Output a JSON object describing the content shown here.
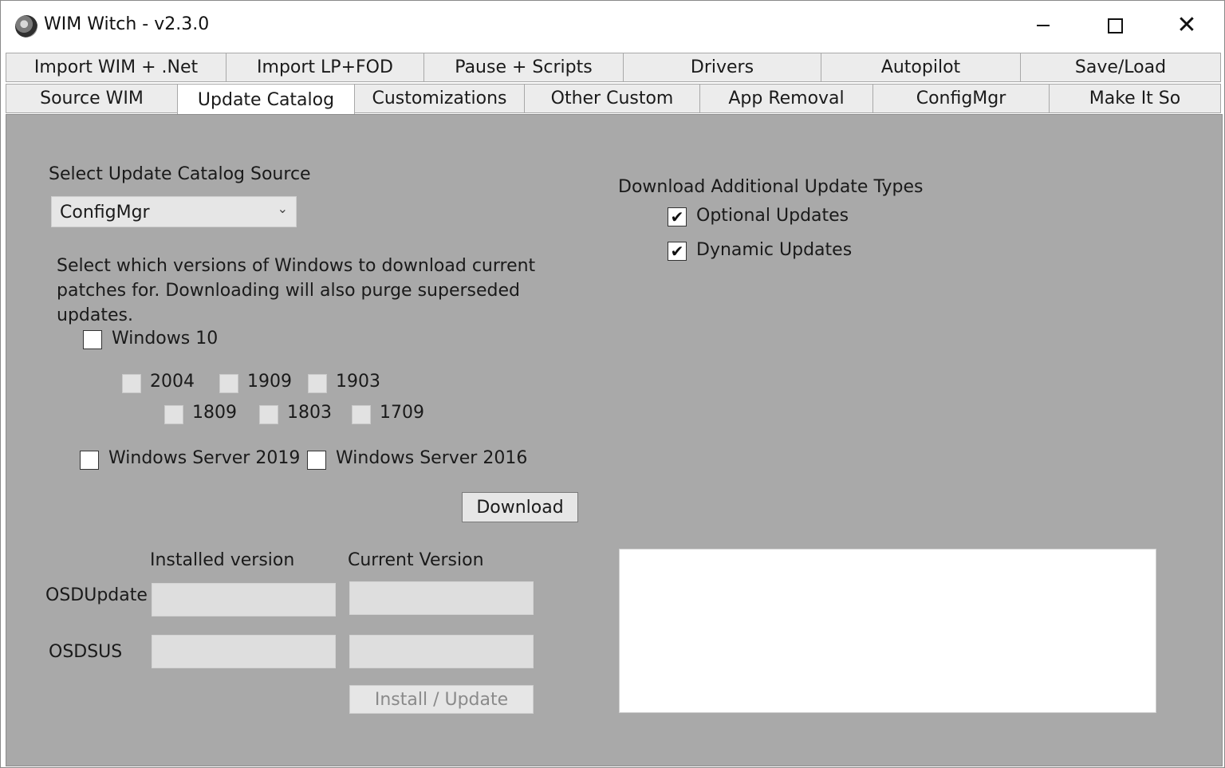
{
  "window": {
    "title": "WIM Witch - v2.3.0",
    "controls": {
      "minimize": "—",
      "maximize": "☐",
      "close": "✕"
    }
  },
  "tabs": {
    "row1": [
      "Import WIM + .Net",
      "Import LP+FOD",
      "Pause + Scripts",
      "Drivers",
      "Autopilot",
      "Save/Load"
    ],
    "row2": [
      "Source WIM",
      "Update Catalog",
      "Customizations",
      "Other Custom",
      "App Removal",
      "ConfigMgr",
      "Make It So"
    ],
    "active": "Update Catalog"
  },
  "catalog": {
    "source_label": "Select Update Catalog Source",
    "source_value": "ConfigMgr",
    "instructions": "Select which versions of Windows to download current patches for. Downloading will also purge superseded updates.",
    "windows10": {
      "label": "Windows 10",
      "checked": false
    },
    "versions_row1": [
      "2004",
      "1909",
      "1903"
    ],
    "versions_row2": [
      "1809",
      "1803",
      "1709"
    ],
    "server2019": {
      "label": "Windows Server 2019",
      "checked": false
    },
    "server2016": {
      "label": "Windows Server 2016",
      "checked": false
    },
    "download_button": "Download"
  },
  "additional": {
    "heading": "Download Additional Update Types",
    "optional": {
      "label": "Optional Updates",
      "checked": true
    },
    "dynamic": {
      "label": "Dynamic Updates",
      "checked": true
    }
  },
  "osd": {
    "installed_header": "Installed version",
    "current_header": "Current Version",
    "rows": [
      {
        "name": "OSDUpdate",
        "installed": "",
        "current": ""
      },
      {
        "name": "OSDSUS",
        "installed": "",
        "current": ""
      }
    ],
    "install_button": "Install / Update"
  },
  "check_glyph": "✔"
}
